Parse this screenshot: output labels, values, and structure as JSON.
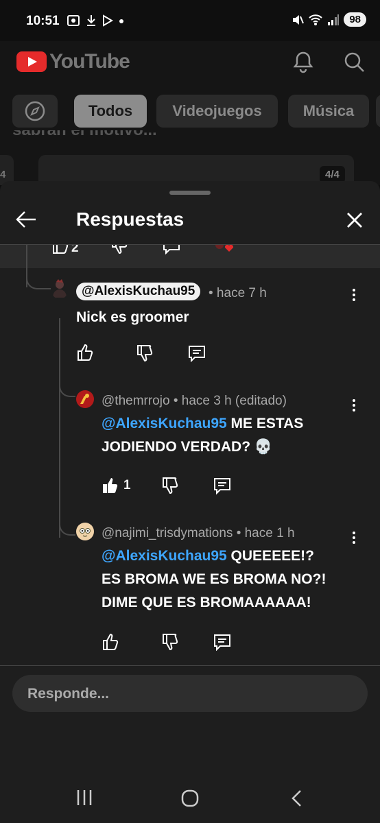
{
  "status_bar": {
    "time": "10:51",
    "battery": "98"
  },
  "header": {
    "logo_text": "YouTube"
  },
  "chips": [
    "Todos",
    "Videojuegos",
    "Música"
  ],
  "background": {
    "partial_text": "sabrán el motivo...",
    "left_badge": "4",
    "badge": "4/4"
  },
  "sheet": {
    "title": "Respuestas"
  },
  "previous_comment": {
    "likes": "2"
  },
  "comments": [
    {
      "handle": "@AlexisKuchau95",
      "time": "• hace 7 h",
      "text": "Nick es groomer",
      "likes": ""
    },
    {
      "handle": "@themrrojo",
      "time": "• hace 3 h (editado)",
      "mention": "@AlexisKuchau95",
      "text_line1": " ME ESTAS",
      "text_line2": "JODIENDO VERDAD? 💀",
      "likes": "1"
    },
    {
      "handle": "@najimi_trisdymations",
      "time": "• hace 1 h",
      "mention": "@AlexisKuchau95",
      "text_line1": " QUEEEEE!?",
      "text_line2": "ES BROMA WE ES BROMA NO?!",
      "text_line3": "DIME QUE ES BROMAAAAAA!",
      "likes": ""
    }
  ],
  "reply_input": {
    "placeholder": "Responde..."
  },
  "colors": {
    "background": "#0f0f0f",
    "sheet": "#1e1e1e",
    "mention": "#3ea6ff",
    "youtube_red": "#e52b2b"
  }
}
